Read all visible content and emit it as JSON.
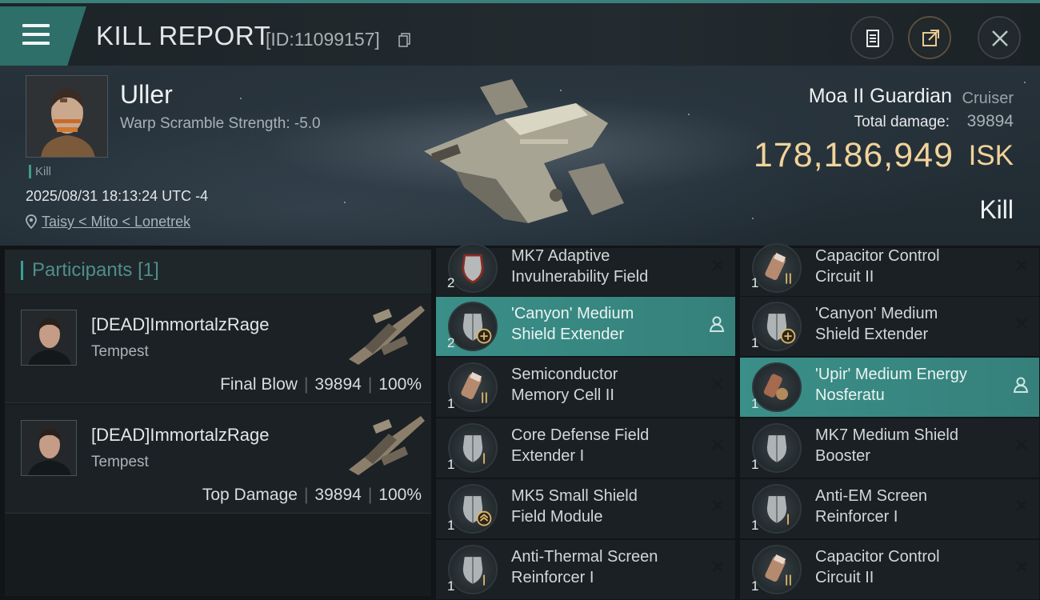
{
  "header": {
    "title": "KILL REPORT",
    "report_id": "[ID:11099157]"
  },
  "victim": {
    "name": "Uller",
    "warp_scramble": "Warp Scramble Strength: -5.0",
    "tag": "Kill",
    "datetime": "2025/08/31 18:13:24 UTC -4",
    "location": "Taisy < Mito < Lonetrek"
  },
  "ship": {
    "name": "Moa II Guardian",
    "class": "Cruiser",
    "total_damage_label": "Total damage:",
    "total_damage": "39894",
    "isk_value": "178,186,949",
    "isk_unit": "ISK",
    "result": "Kill"
  },
  "participants": {
    "title": "Participants",
    "count": "[1]",
    "items": [
      {
        "name": "[DEAD]ImmortalzRage",
        "ship": "Tempest",
        "role": "Final Blow",
        "damage": "39894",
        "percent": "100%"
      },
      {
        "name": "[DEAD]ImmortalzRage",
        "ship": "Tempest",
        "role": "Top Damage",
        "damage": "39894",
        "percent": "100%"
      }
    ]
  },
  "modules": {
    "left": [
      {
        "name1": "MK7 Adaptive",
        "name2": "Invulnerability Field",
        "qty": "2",
        "icon": "adaptive-invulnerability-icon",
        "tier": "",
        "highlight": false
      },
      {
        "name1": "'Canyon' Medium",
        "name2": "Shield Extender",
        "qty": "2",
        "icon": "shield-extender-icon",
        "tier": "+",
        "highlight": true
      },
      {
        "name1": "Semiconductor",
        "name2": "Memory Cell II",
        "qty": "1",
        "icon": "capacitor-battery-icon",
        "tier": "II",
        "highlight": false
      },
      {
        "name1": "Core Defense Field",
        "name2": "Extender I",
        "qty": "1",
        "icon": "shield-rig-icon",
        "tier": "I",
        "highlight": false
      },
      {
        "name1": "MK5 Small Shield",
        "name2": "Field Module",
        "qty": "1",
        "icon": "shield-module-icon",
        "tier": "chevron",
        "highlight": false
      },
      {
        "name1": "Anti-Thermal Screen",
        "name2": "Reinforcer I",
        "qty": "1",
        "icon": "shield-rig-icon",
        "tier": "I",
        "highlight": false
      }
    ],
    "right": [
      {
        "name1": "Capacitor Control",
        "name2": "Circuit II",
        "qty": "1",
        "icon": "capacitor-battery-icon",
        "tier": "II",
        "highlight": false
      },
      {
        "name1": "'Canyon' Medium",
        "name2": "Shield Extender",
        "qty": "1",
        "icon": "shield-extender-icon",
        "tier": "+",
        "highlight": false
      },
      {
        "name1": "'Upir' Medium Energy",
        "name2": "Nosferatu",
        "qty": "1",
        "icon": "energy-nosferatu-icon",
        "tier": "",
        "highlight": true
      },
      {
        "name1": "MK7 Medium Shield",
        "name2": "Booster",
        "qty": "1",
        "icon": "shield-booster-icon",
        "tier": "",
        "highlight": false
      },
      {
        "name1": "Anti-EM Screen",
        "name2": "Reinforcer I",
        "qty": "1",
        "icon": "shield-rig-icon",
        "tier": "I",
        "highlight": false
      },
      {
        "name1": "Capacitor Control",
        "name2": "Circuit II",
        "qty": "1",
        "icon": "capacitor-battery-icon",
        "tier": "II",
        "highlight": false
      }
    ]
  },
  "colors": {
    "accent": "#3a8f88",
    "isk": "#f1d39a",
    "panel": "#1a2023"
  }
}
